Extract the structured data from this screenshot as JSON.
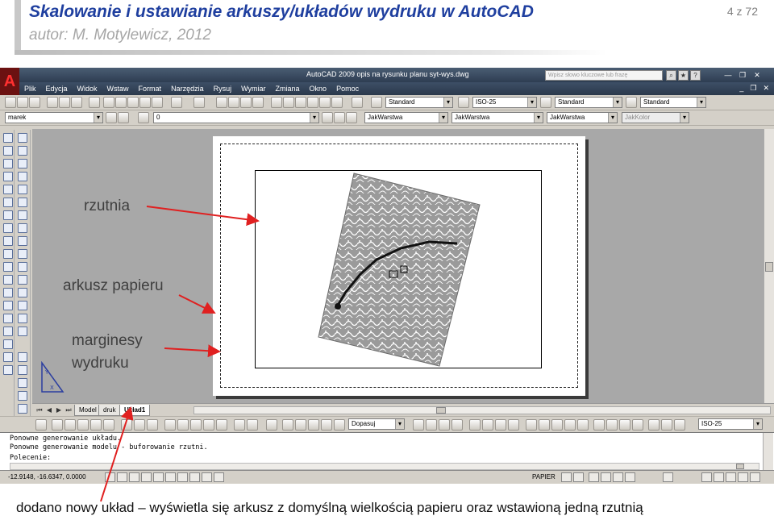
{
  "slide": {
    "title": "Skalowanie i ustawianie arkuszy/układów wydruku w AutoCAD",
    "author": "autor: M. Motylewicz, 2012",
    "page_counter": "4 z 72"
  },
  "app": {
    "window_title": "AutoCAD 2009 opis na rysunku planu syt-wys.dwg",
    "search_placeholder": "Wpisz słowo kluczowe lub frazę",
    "menu": [
      "Plik",
      "Edycja",
      "Widok",
      "Wstaw",
      "Format",
      "Narzędzia",
      "Rysuj",
      "Wymiar",
      "Zmiana",
      "Okno",
      "Pomoc"
    ]
  },
  "toolbar": {
    "text_style": "Standard",
    "dim_style": "ISO-25",
    "table_style": "Standard",
    "multileader_style": "Standard",
    "workspace": "marek",
    "layer": "0",
    "color": "JakWarstwa",
    "linetype": "JakWarstwa",
    "lineweight": "JakWarstwa",
    "plot_style": "JakKolor"
  },
  "layout_tabs": [
    "Model",
    "druk",
    "Układ1"
  ],
  "active_tab": "Układ1",
  "lower_toolbar": {
    "viewport_scale": "Dopasuj",
    "dim_style": "ISO-25"
  },
  "command_line": [
    "Ponowne generowanie układu.",
    "Ponowne generowanie modelu - buforowanie rzutni.",
    "Polecenie:"
  ],
  "status": {
    "coordinates": "-12.9148, -16.6347, 0.0000",
    "space": "PAPIER"
  },
  "annotations": {
    "viewport": "rzutnia",
    "paper_sheet": "arkusz papieru",
    "margins_line1": "marginesy",
    "margins_line2": "wydruku",
    "caption": "dodano nowy układ – wyświetla się arkusz z domyślną wielkością papieru oraz wstawioną jedną rzutnią"
  },
  "colors": {
    "title": "#1f3f9f",
    "author": "#a6a6a6",
    "arrow": "#e02020",
    "acad_title": "#2e3d52"
  }
}
